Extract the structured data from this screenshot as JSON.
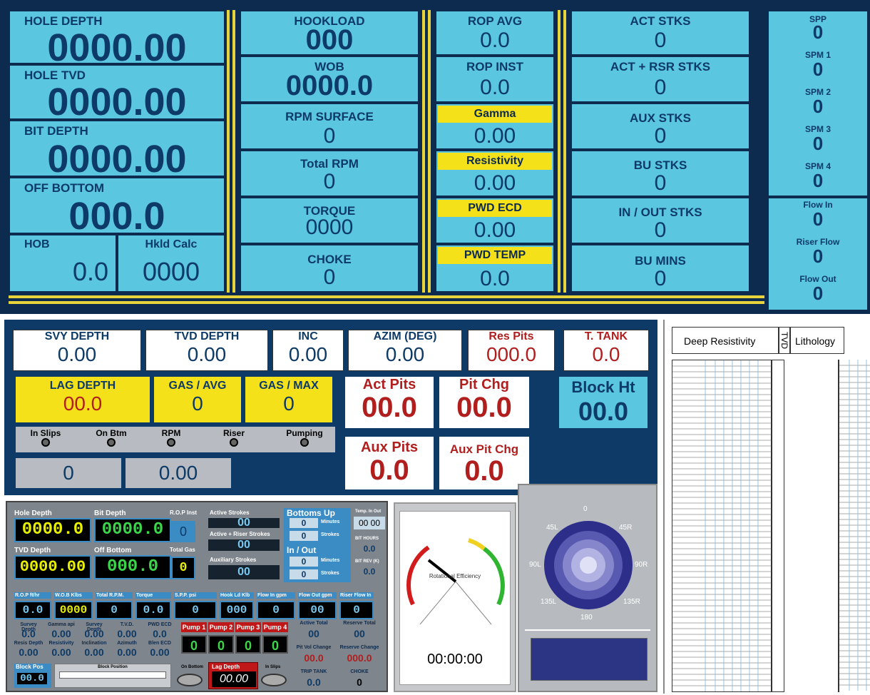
{
  "top": {
    "hole_depth": {
      "label": "HOLE DEPTH",
      "value": "0000.00"
    },
    "hole_tvd": {
      "label": "HOLE TVD",
      "value": "0000.00"
    },
    "bit_depth": {
      "label": "BIT DEPTH",
      "value": "0000.00"
    },
    "off_bottom": {
      "label": "OFF BOTTOM",
      "value": "000.0"
    },
    "hob": {
      "label": "HOB",
      "value": "0.0"
    },
    "hkld_calc": {
      "label": "Hkld Calc",
      "value": "0000"
    },
    "hookload": {
      "label": "HOOKLOAD",
      "value": "000"
    },
    "wob": {
      "label": "WOB",
      "value": "0000.0"
    },
    "rpm_surface": {
      "label": "RPM SURFACE",
      "value": "0"
    },
    "total_rpm": {
      "label": "Total RPM",
      "value": "0"
    },
    "torque": {
      "label": "TORQUE",
      "value": "0000"
    },
    "choke": {
      "label": "CHOKE",
      "value": "0"
    },
    "rop_avg": {
      "label": "ROP AVG",
      "value": "0.0"
    },
    "rop_inst": {
      "label": "ROP INST",
      "value": "0.0"
    },
    "gamma": {
      "label": "Gamma",
      "value": "0.00"
    },
    "resistivity": {
      "label": "Resistivity",
      "value": "0.00"
    },
    "pwd_ecd": {
      "label": "PWD ECD",
      "value": "0.00"
    },
    "pwd_temp": {
      "label": "PWD TEMP",
      "value": "0.0"
    },
    "act_stks": {
      "label": "ACT STKS",
      "value": "0"
    },
    "act_rsr_stks": {
      "label": "ACT + RSR STKS",
      "value": "0"
    },
    "aux_stks": {
      "label": "AUX STKS",
      "value": "0"
    },
    "bu_stks": {
      "label": "BU STKS",
      "value": "0"
    },
    "in_out_stks": {
      "label": "IN / OUT STKS",
      "value": "0"
    },
    "bu_mins": {
      "label": "BU MINS",
      "value": "0"
    },
    "spp": {
      "label": "SPP",
      "value": "0"
    },
    "spm1": {
      "label": "SPM 1",
      "value": "0"
    },
    "spm2": {
      "label": "SPM 2",
      "value": "0"
    },
    "spm3": {
      "label": "SPM 3",
      "value": "0"
    },
    "spm4": {
      "label": "SPM 4",
      "value": "0"
    },
    "flow_in": {
      "label": "Flow In",
      "value": "0"
    },
    "riser_flow": {
      "label": "Riser Flow",
      "value": "0"
    },
    "flow_out": {
      "label": "Flow Out",
      "value": "0"
    }
  },
  "mid": {
    "svy_depth": {
      "label": "SVY DEPTH",
      "value": "0.00"
    },
    "tvd_depth": {
      "label": "TVD DEPTH",
      "value": "0.00"
    },
    "inc": {
      "label": "INC",
      "value": "0.00"
    },
    "azim": {
      "label": "AZIM (DEG)",
      "value": "0.00"
    },
    "res_pits": {
      "label": "Res Pits",
      "value": "000.0"
    },
    "t_tank": {
      "label": "T. TANK",
      "value": "0.0"
    },
    "lag_depth": {
      "label": "LAG DEPTH",
      "value": "00.0"
    },
    "gas_avg": {
      "label": "GAS / AVG",
      "value": "0"
    },
    "gas_max": {
      "label": "GAS / MAX",
      "value": "0"
    },
    "act_pits": {
      "label": "Act Pits",
      "value": "00.0"
    },
    "pit_chg": {
      "label": "Pit Chg",
      "value": "00.0"
    },
    "block_ht": {
      "label": "Block Ht",
      "value": "00.0"
    },
    "aux_pits": {
      "label": "Aux Pits",
      "value": "0.0"
    },
    "aux_pit_chg": {
      "label": "Aux Pit Chg",
      "value": "0.0"
    },
    "indicators": [
      "In Slips",
      "On Btm",
      "RPM",
      "Riser",
      "Pumping"
    ],
    "bottom_val1": "0",
    "bottom_val2": "0.00"
  },
  "bl": {
    "hole_depth": {
      "label": "Hole Depth",
      "value": "0000.0"
    },
    "bit_depth": {
      "label": "Bit Depth",
      "value": "0000.0"
    },
    "rop_inst": {
      "label": "R.O.P Inst",
      "value": "0"
    },
    "tvd_depth": {
      "label": "TVD Depth",
      "value": "0000.00"
    },
    "off_bottom": {
      "label": "Off Bottom",
      "value": "000.0"
    },
    "total_gas": {
      "label": "Total Gas",
      "value": "0"
    },
    "active_strokes": {
      "label": "Active Strokes",
      "value": "00"
    },
    "active_riser_strokes": {
      "label": "Active + Riser Strokes",
      "value": "00"
    },
    "aux_strokes": {
      "label": "Auxiliary Strokes",
      "value": "00"
    },
    "bottoms_up": "Bottoms Up",
    "in_out": "In / Out",
    "minutes": "Minutes",
    "strokes": "Strokes",
    "bu_min": "0",
    "bu_stk": "0",
    "io_min": "0",
    "io_stk": "0",
    "temp_in_out": {
      "label": "Temp. In Out",
      "value": "00 00"
    },
    "bit_hours": {
      "label": "BIT HOURS",
      "value": "0.0"
    },
    "bit_rev": {
      "label": "BIT REV (K)",
      "value": "0.0"
    },
    "row": [
      {
        "label": "R.O.P ft/hr",
        "value": "0.0"
      },
      {
        "label": "W.O.B Klbs",
        "value": "0000"
      },
      {
        "label": "Total R.P.M.",
        "value": "0"
      },
      {
        "label": "Torque",
        "value": "0.0"
      },
      {
        "label": "S.P.P. psi",
        "value": "0"
      },
      {
        "label": "Hook Ld Klb",
        "value": "000"
      },
      {
        "label": "Flow In gpm",
        "value": "0"
      },
      {
        "label": "Flow Out gpm",
        "value": "00"
      },
      {
        "label": "Riser Flow In",
        "value": "0"
      }
    ],
    "survey": [
      {
        "label": "Survey Depth",
        "value": "0.0"
      },
      {
        "label": "Gamma api",
        "value": "0.00"
      },
      {
        "label": "Survey Depth",
        "value": "0.00"
      },
      {
        "label": "T.V.D.",
        "value": "0.00"
      },
      {
        "label": "PWD ECD",
        "value": "0.0"
      },
      {
        "label": "Resis Depth",
        "value": "0.00"
      },
      {
        "label": "Resistivity",
        "value": "0.00"
      },
      {
        "label": "Inclination",
        "value": "0.00"
      },
      {
        "label": "Azimuth",
        "value": "0.00"
      },
      {
        "label": "Blen ECD",
        "value": "0.00"
      }
    ],
    "pumps": [
      {
        "label": "Pump 1",
        "value": "0"
      },
      {
        "label": "Pump 2",
        "value": "0"
      },
      {
        "label": "Pump 3",
        "value": "0"
      },
      {
        "label": "Pump 4",
        "value": "0"
      }
    ],
    "active_total": {
      "label": "Active Total",
      "value": "00"
    },
    "reserve_total": {
      "label": "Reserve Total",
      "value": "00"
    },
    "pit_vol_change": {
      "label": "Pit Vol Change",
      "value": "00.0"
    },
    "reserve_change": {
      "label": "Reserve Change",
      "value": "000.0"
    },
    "trip_tank": {
      "label": "TRIP TANK",
      "value": "0.0"
    },
    "choke": {
      "label": "CHOKE",
      "value": "0"
    },
    "block_pos": {
      "label": "Block Pos",
      "value": "00.0"
    },
    "block_position": "Block Position",
    "on_bottom": "On Bottom",
    "in_slips": "In Slips",
    "lag_depth": {
      "label": "Lag Depth",
      "value": "00.00"
    }
  },
  "gauge": {
    "label": "Rotational Efficiency",
    "time": "00:00:00",
    "needle_value": -20
  },
  "rose": {
    "labels": [
      "0",
      "45L",
      "45R",
      "90L",
      "90R",
      "135L",
      "135R",
      "180"
    ]
  },
  "log": {
    "deep_resistivity": "Deep Resistivity",
    "tvd": "TVD",
    "lithology": "Lithology"
  },
  "colors": {
    "panel_dark": "#0d2b4e",
    "cyan": "#5bc6e0",
    "yellow": "#f5e11a",
    "red_value": "#b01e1e"
  }
}
